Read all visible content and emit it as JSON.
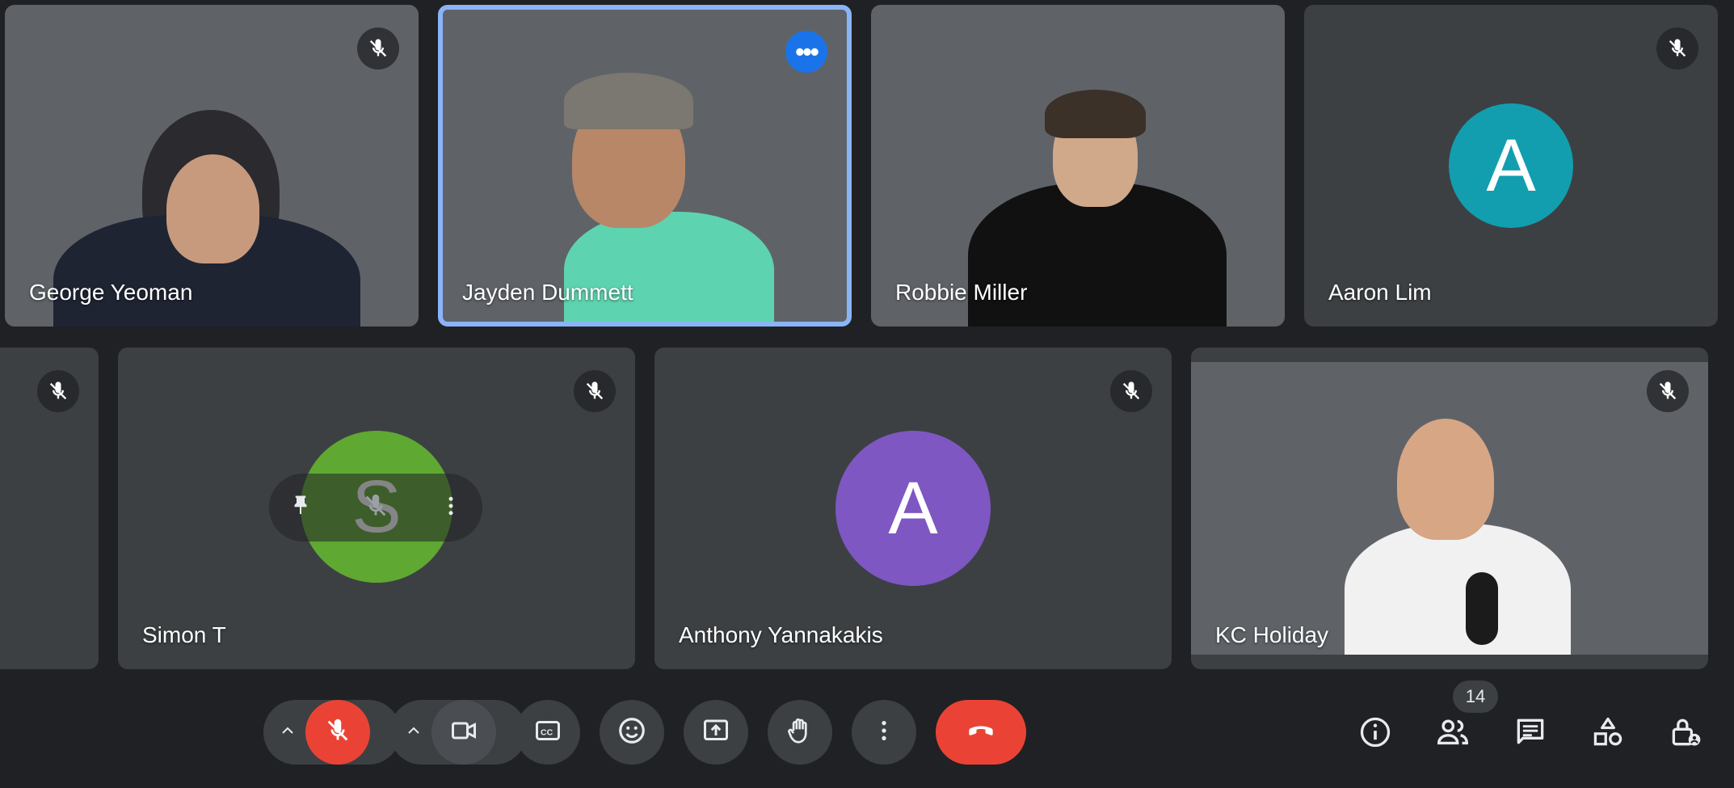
{
  "participants": [
    {
      "name": "George Yeoman",
      "muted": true
    },
    {
      "name": "Jayden Dummett",
      "muted": false,
      "speaking": true
    },
    {
      "name": "Robbie Miller",
      "muted": false
    },
    {
      "name": "Aaron Lim",
      "muted": true,
      "avatar_letter": "A",
      "avatar_color": "#129eaf"
    },
    {
      "name": "Simon T",
      "muted": true,
      "avatar_letter": "S",
      "avatar_color": "#5fa832"
    },
    {
      "name": "Anthony Yannakakis",
      "muted": true,
      "avatar_letter": "A",
      "avatar_color": "#7e57c2"
    },
    {
      "name": "KC Holiday",
      "muted": true
    }
  ],
  "controls": {
    "participant_count": "14",
    "end_call_color": "#ea4335",
    "mic_off_color": "#ea4335",
    "accent_color": "#8ab4f8"
  },
  "icons": [
    "mic-off-icon",
    "more-horizontal-icon",
    "pin-icon",
    "more-vertical-icon",
    "chevron-up-icon",
    "camera-icon",
    "captions-icon",
    "emoji-icon",
    "present-icon",
    "raise-hand-icon",
    "more-options-icon",
    "end-call-icon",
    "info-icon",
    "people-icon",
    "chat-icon",
    "activities-icon",
    "host-controls-icon"
  ]
}
